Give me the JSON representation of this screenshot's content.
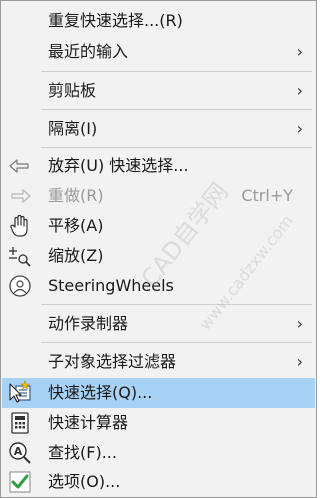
{
  "menu": {
    "items": [
      {
        "label": "重复快速选择...(R)",
        "arrow": "",
        "shortcut": ""
      },
      {
        "label": "最近的输入",
        "arrow": "›",
        "shortcut": ""
      },
      {
        "label": "剪贴板",
        "arrow": "›",
        "shortcut": ""
      },
      {
        "label": "隔离(I)",
        "arrow": "›",
        "shortcut": ""
      },
      {
        "label": "放弃(U) 快速选择...",
        "arrow": "",
        "shortcut": ""
      },
      {
        "label": "重做(R)",
        "arrow": "",
        "shortcut": "Ctrl+Y"
      },
      {
        "label": "平移(A)",
        "arrow": "",
        "shortcut": ""
      },
      {
        "label": "缩放(Z)",
        "arrow": "",
        "shortcut": ""
      },
      {
        "label": "SteeringWheels",
        "arrow": "",
        "shortcut": ""
      },
      {
        "label": "动作录制器",
        "arrow": "›",
        "shortcut": ""
      },
      {
        "label": "子对象选择过滤器",
        "arrow": "›",
        "shortcut": ""
      },
      {
        "label": "快速选择(Q)...",
        "arrow": "",
        "shortcut": ""
      },
      {
        "label": "快速计算器",
        "arrow": "",
        "shortcut": ""
      },
      {
        "label": "查找(F)...",
        "arrow": "",
        "shortcut": ""
      },
      {
        "label": "选项(O)...",
        "arrow": "",
        "shortcut": ""
      }
    ]
  },
  "watermark": {
    "line1": "CAD自学网",
    "line2": "www.cadzxw.com"
  },
  "colors": {
    "menu_bg": "#f2f2f2",
    "highlight": "#a8d2f5",
    "disabled_text": "#9a9a9a",
    "check_green": "#2e9e3e"
  }
}
